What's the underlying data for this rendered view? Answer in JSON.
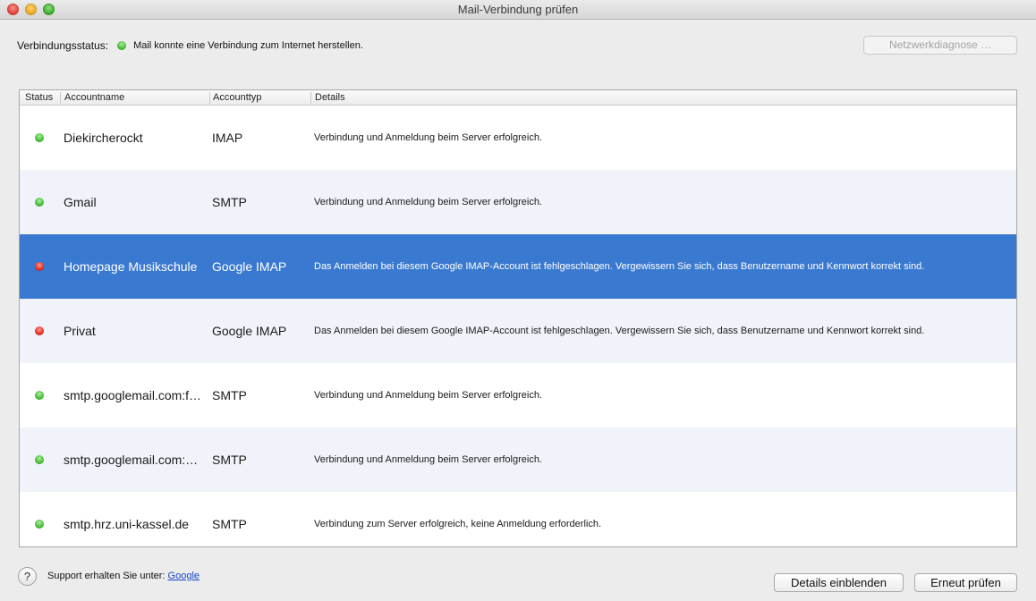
{
  "window": {
    "title": "Mail-Verbindung prüfen"
  },
  "status": {
    "label": "Verbindungsstatus:",
    "text": "Mail konnte eine Verbindung zum Internet herstellen.",
    "color": "#3fb52f"
  },
  "buttons": {
    "diagnose": "Netzwerkdiagnose …",
    "details": "Details einblenden",
    "retry": "Erneut prüfen",
    "help": "?"
  },
  "table": {
    "headers": {
      "status": "Status",
      "name": "Accountname",
      "type": "Accounttyp",
      "details": "Details"
    },
    "rows": [
      {
        "status": "green",
        "name": "Diekircherockt",
        "type": "IMAP",
        "details": "Verbindung und Anmeldung beim Server erfolgreich.",
        "selected": false
      },
      {
        "status": "green",
        "name": "Gmail",
        "type": "SMTP",
        "details": "Verbindung und Anmeldung beim Server erfolgreich.",
        "selected": false
      },
      {
        "status": "red",
        "name": "Homepage Musikschule",
        "type": "Google IMAP",
        "details": "Das Anmelden bei diesem Google IMAP-Account ist fehlgeschlagen. Vergewissern Sie sich, dass Benutzername und Kennwort korrekt sind.",
        "selected": true
      },
      {
        "status": "red",
        "name": "Privat",
        "type": "Google IMAP",
        "details": "Das Anmelden bei diesem Google IMAP-Account ist fehlgeschlagen. Vergewissern Sie sich, dass Benutzername und Kennwort korrekt sind.",
        "selected": false
      },
      {
        "status": "green",
        "name": "smtp.googlemail.com:f…",
        "type": "SMTP",
        "details": "Verbindung und Anmeldung beim Server erfolgreich.",
        "selected": false
      },
      {
        "status": "green",
        "name": "smtp.googlemail.com:…",
        "type": "SMTP",
        "details": "Verbindung und Anmeldung beim Server erfolgreich.",
        "selected": false
      },
      {
        "status": "green",
        "name": "smtp.hrz.uni-kassel.de",
        "type": "SMTP",
        "details": "Verbindung zum Server erfolgreich, keine Anmeldung erforderlich.",
        "selected": false
      }
    ]
  },
  "footer": {
    "support_text": "Support erhalten Sie unter:",
    "support_link": "Google"
  },
  "colors": {
    "selection": "#3a79d0",
    "ok": "#3fb52f",
    "error": "#e1251b"
  }
}
